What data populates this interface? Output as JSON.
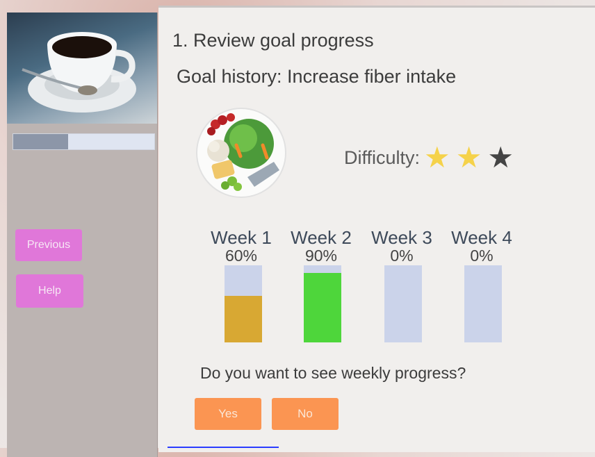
{
  "sidebar": {
    "progress_fraction": 0.39,
    "previous_label": "Previous",
    "help_label": "Help"
  },
  "main": {
    "title": "1. Review goal progress",
    "subtitle": "Goal history: Increase fiber intake",
    "difficulty_label": "Difficulty:",
    "difficulty_stars": 2,
    "difficulty_max": 3,
    "weeks": [
      {
        "label": "Week 1",
        "percent_text": "60%",
        "value": 60,
        "color": "#d8a833"
      },
      {
        "label": "Week 2",
        "percent_text": "90%",
        "value": 90,
        "color": "#4ed63b"
      },
      {
        "label": "Week 3",
        "percent_text": "0%",
        "value": 0,
        "color": "#cbd3ea"
      },
      {
        "label": "Week 4",
        "percent_text": "0%",
        "value": 0,
        "color": "#cbd3ea"
      }
    ],
    "question": "Do you want to see weekly progress?",
    "yes_label": "Yes",
    "no_label": "No"
  },
  "colors": {
    "side_button": "#e077d9",
    "answer_button": "#fb9552",
    "star_filled": "#f5d24a",
    "star_empty": "#444444",
    "bar_track": "#cbd3ea"
  }
}
